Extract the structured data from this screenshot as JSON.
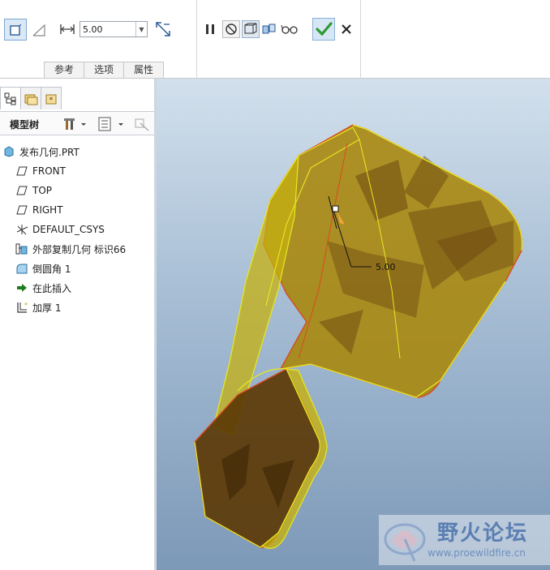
{
  "dashboard": {
    "depth_value": "5.00",
    "tabs": [
      "参考",
      "选项",
      "属性"
    ],
    "icons": [
      "thicken-solid-icon",
      "thicken-surface-icon",
      "depth-dimension-icon",
      "flip-direction-icon",
      "pause-icon",
      "no-preview-icon",
      "preview-geometry-icon",
      "verify-icon",
      "glasses-icon",
      "ok-check-icon",
      "cancel-x-icon"
    ]
  },
  "panel": {
    "tree_title": "模型树",
    "items": [
      {
        "label": "发布几何.PRT",
        "icon": "part-icon"
      },
      {
        "label": "FRONT",
        "icon": "datum-plane-icon"
      },
      {
        "label": "TOP",
        "icon": "datum-plane-icon"
      },
      {
        "label": "RIGHT",
        "icon": "datum-plane-icon"
      },
      {
        "label": "DEFAULT_CSYS",
        "icon": "csys-icon"
      },
      {
        "label": "外部复制几何 标识66",
        "icon": "external-copy-icon"
      },
      {
        "label": "倒圆角 1",
        "icon": "round-icon"
      },
      {
        "label": "在此插入",
        "icon": "insert-here-arrow-icon"
      },
      {
        "label": "加厚 1",
        "icon": "thicken-feature-icon"
      }
    ]
  },
  "viewport": {
    "dimension_label": "5.00"
  },
  "watermark": {
    "title": "野火论坛",
    "url": "www.proewildfire.cn"
  },
  "colors": {
    "model_fill": "#a8860a",
    "model_edge": "#e8e820",
    "model_outline": "#d84a1e",
    "ok_green": "#2e9a33"
  }
}
